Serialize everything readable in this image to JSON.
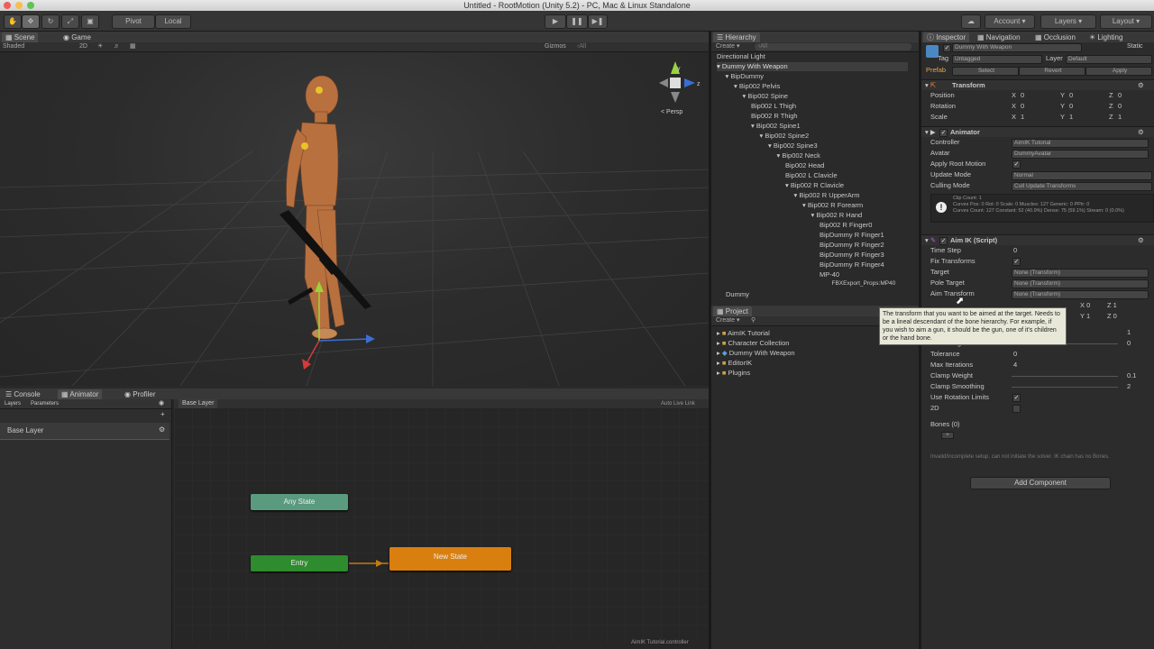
{
  "window": {
    "title": "Untitled - RootMotion (Unity 5.2) - PC, Mac & Linux Standalone"
  },
  "toolbar": {
    "pivot": "Pivot",
    "local": "Local",
    "account": "Account",
    "layers": "Layers",
    "layout": "Layout"
  },
  "scene": {
    "tabs": [
      "Scene",
      "Game"
    ],
    "shading": "Shaded",
    "mode2d": "2D",
    "gizmos": "Gizmos",
    "search_placeholder": "‹All",
    "persp": "< Persp"
  },
  "hierarchy": {
    "tab": "Hierarchy",
    "create": "Create",
    "search_placeholder": "‹All",
    "items": [
      "Directional Light",
      "Dummy With Weapon",
      "BipDummy",
      "Bip002 Pelvis",
      "Bip002 Spine",
      "Bip002 L Thigh",
      "Bip002 R Thigh",
      "Bip002 Spine1",
      "Bip002 Spine2",
      "Bip002 Spine3",
      "Bip002 Neck",
      "Bip002 Head",
      "Bip002 L Clavicle",
      "Bip002 R Clavicle",
      "Bip002 R UpperArm",
      "Bip002 R Forearm",
      "Bip002 R Hand",
      "Bip002 R Finger0",
      "BipDummy R Finger1",
      "BipDummy R Finger2",
      "BipDummy R Finger3",
      "BipDummy R Finger4",
      "MP-40",
      "FBXExport_Props:MP40",
      "Dummy"
    ]
  },
  "project": {
    "tab": "Project",
    "create": "Create",
    "items": [
      "AimIK Tutorial",
      "Character Collection",
      "Dummy With Weapon",
      "EditorIK",
      "Plugins"
    ]
  },
  "inspector": {
    "tabs": [
      "Inspector",
      "Navigation",
      "Occlusion",
      "Lighting"
    ],
    "object_name": "Dummy With Weapon",
    "static": "Static",
    "tag_label": "Tag",
    "tag_value": "Untagged",
    "layer_label": "Layer",
    "layer_value": "Default",
    "prefab_label": "Prefab",
    "prefab_select": "Select",
    "prefab_revert": "Revert",
    "prefab_apply": "Apply",
    "transform": {
      "title": "Transform",
      "position_label": "Position",
      "rotation_label": "Rotation",
      "scale_label": "Scale",
      "x": "X",
      "y": "Y",
      "z": "Z",
      "position": [
        "0",
        "0",
        "0"
      ],
      "rotation": [
        "0",
        "0",
        "0"
      ],
      "scale": [
        "1",
        "1",
        "1"
      ]
    },
    "animator": {
      "title": "Animator",
      "controller_label": "Controller",
      "controller": "AimIK Tutorial",
      "avatar_label": "Avatar",
      "avatar": "DummyAvatar",
      "root_motion_label": "Apply Root Motion",
      "update_mode_label": "Update Mode",
      "update_mode": "Normal",
      "culling_label": "Culling Mode",
      "culling": "Cull Update Transforms",
      "info": "Clip Count: 1\nCurves Pos: 0 Rot: 0 Scale: 0 Muscles: 127 Generic: 0 PPtr: 0\nCurves Count: 127 Constant: 52 (40.9%) Dense: 75 (59.1%) Stream: 0 (0.0%)"
    },
    "aimik": {
      "title": "Aim IK (Script)",
      "timestep_label": "Time Step",
      "timestep": "0",
      "fix_label": "Fix Transforms",
      "target_label": "Target",
      "target": "None (Transform)",
      "pole_label": "Pole Target",
      "pole": "None (Transform)",
      "aim_label": "Aim Transform",
      "aim": "None (Transform)",
      "axis_x": "0",
      "axis_z": "1",
      "pole_axis_y": "1",
      "pole_axis_z": "0",
      "weight": "1",
      "pole_weight_label": "Pole Weight",
      "pole_weight": "0",
      "tolerance_label": "Tolerance",
      "tolerance": "0",
      "max_iter_label": "Max Iterations",
      "max_iter": "4",
      "clamp_weight_label": "Clamp Weight",
      "clamp_weight": "0.1",
      "clamp_smooth_label": "Clamp Smoothing",
      "clamp_smooth": "2",
      "rot_limits_label": "Use Rotation Limits",
      "label_2d": "2D",
      "bones_label": "Bones (0)",
      "warning": "Invalid/incomplete setup, can not initiate the solver. IK chain has no Bones."
    },
    "add_component": "Add Component",
    "tooltip": "The transform that you want to be aimed at the target. Needs to be a lineal descendant of the bone hierarchy. For example, if you wish to aim a gun, it should be the gun, one of it's children or the hand bone."
  },
  "bottom": {
    "tabs": [
      "Console",
      "Animator",
      "Profiler"
    ],
    "layers_tab": "Layers",
    "params_tab": "Parameters",
    "base_layer": "Base Layer",
    "breadcrumb": "Base Layer",
    "auto_live": "Auto Live Link",
    "states": {
      "any": "Any State",
      "entry": "Entry",
      "new_state": "New State"
    },
    "status": "AimIK Tutorial.controller"
  },
  "colors": {
    "any_state": "#5a9a7e",
    "entry": "#2e8b2e",
    "new_state": "#d97f10"
  }
}
